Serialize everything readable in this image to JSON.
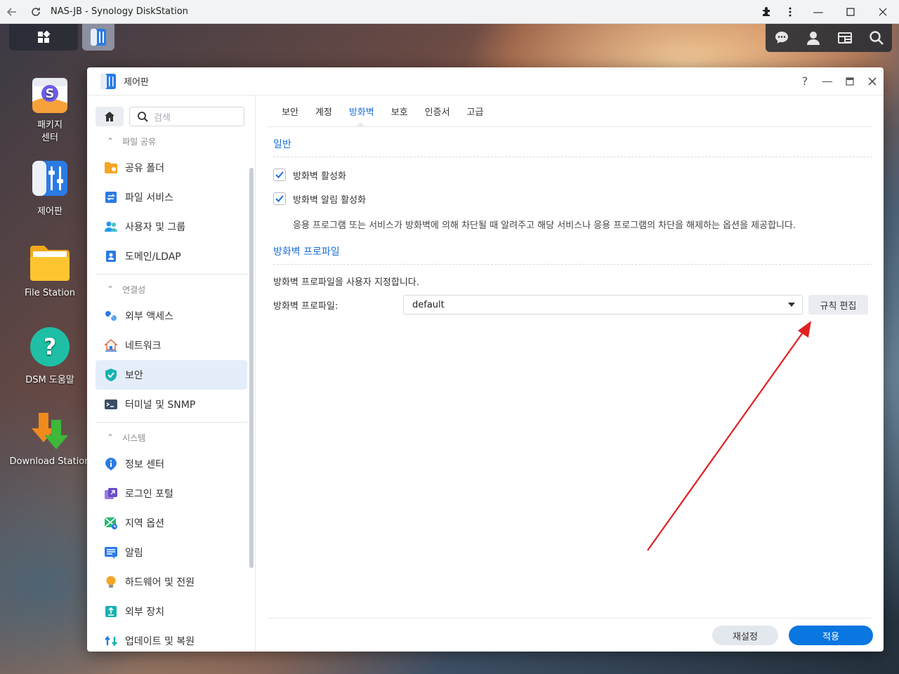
{
  "browser": {
    "title": "NAS-JB - Synology DiskStation"
  },
  "desktop": {
    "icons": [
      {
        "label": "패키지\n센터"
      },
      {
        "label": "제어판"
      },
      {
        "label": "File Station"
      },
      {
        "label": "DSM 도움말"
      },
      {
        "label": "Download Station"
      }
    ]
  },
  "window": {
    "title": "제어판",
    "search_placeholder": "검색",
    "sidebar": {
      "groups": [
        {
          "label": "파일 공유",
          "items": [
            "공유 폴더",
            "파일 서비스",
            "사용자 및 그룹",
            "도메인/LDAP"
          ]
        },
        {
          "label": "연결성",
          "items": [
            "외부 액세스",
            "네트워크",
            "보안",
            "터미널 및 SNMP"
          ]
        },
        {
          "label": "시스템",
          "items": [
            "정보 센터",
            "로그인 포털",
            "지역 옵션",
            "알림",
            "하드웨어 및 전원",
            "외부 장치",
            "업데이트 및 복원"
          ]
        }
      ],
      "active": "보안"
    },
    "tabs": [
      "보안",
      "계정",
      "방화벽",
      "보호",
      "인증서",
      "고급"
    ],
    "active_tab": "방화벽",
    "general": {
      "title": "일반",
      "enable_firewall": "방화벽 활성화",
      "enable_notifications": "방화벽 알림 활성화",
      "description": "응용 프로그램 또는 서비스가 방화벽에 의해 차단될 때 알려주고 해당 서비스나 응용 프로그램의 차단을 해제하는 옵션을 제공합니다."
    },
    "profile": {
      "title": "방화벽 프로파일",
      "description": "방화벽 프로파일을 사용자 지정합니다.",
      "label": "방화벽 프로파일:",
      "value": "default",
      "edit_button": "규칙 편집"
    },
    "footer": {
      "reset": "재설정",
      "apply": "적용"
    }
  },
  "colors": {
    "accent": "#1b6ed6",
    "apply_button": "#0a76e0",
    "annotation_arrow": "#e02020"
  }
}
